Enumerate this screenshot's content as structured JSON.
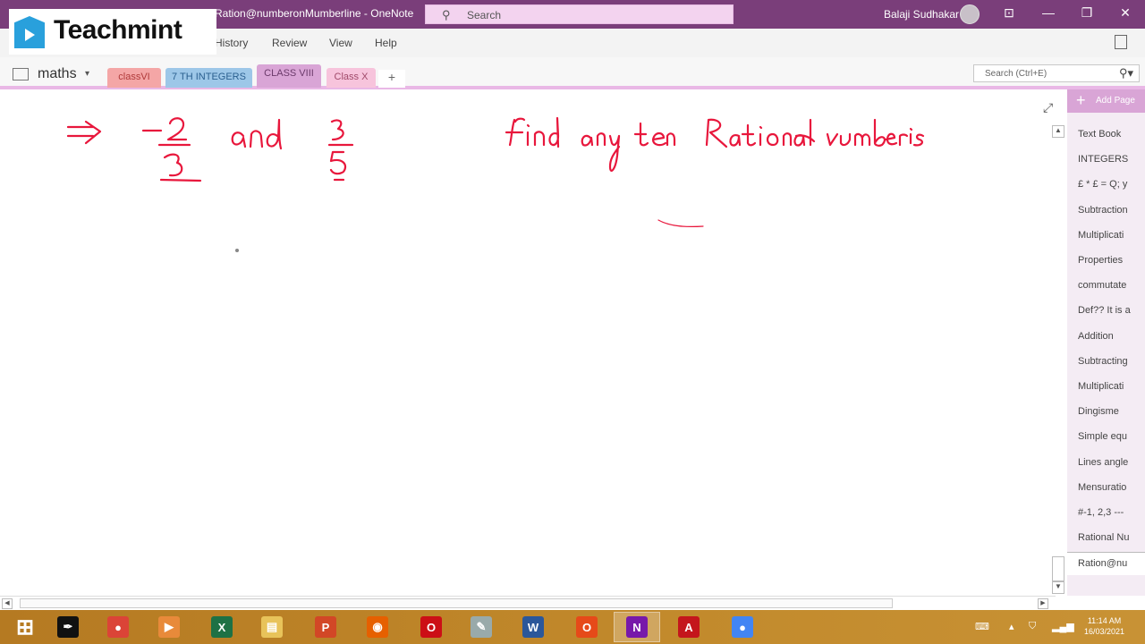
{
  "window": {
    "title": "Ration@numberonMumberline - OneNote",
    "search_placeholder": "Search",
    "user_name": "Balaji Sudhakar",
    "controls": {
      "ribbon_display": "⊡",
      "minimize": "—",
      "restore": "❐",
      "close": "✕"
    }
  },
  "watermark": {
    "brand": "Teachmint"
  },
  "ribbon": {
    "menu": [
      "History",
      "Review",
      "View",
      "Help"
    ]
  },
  "notebook": {
    "name": "maths",
    "caret": "▾",
    "sections": [
      {
        "label": "classVI",
        "color": "#f4a6a6",
        "text_color": "#b03a3a"
      },
      {
        "label": "7 TH INTEGERS",
        "color": "#9dc7e8",
        "text_color": "#2a5f8f"
      },
      {
        "label": "CLASS VIII",
        "color": "#d9a5d6",
        "text_color": "#6a3a6a"
      },
      {
        "label": "Class X",
        "color": "#f7c4dc",
        "text_color": "#a04a6a"
      }
    ],
    "add_section": "+",
    "search_placeholder": "Search (Ctrl+E)"
  },
  "page_pane": {
    "add_page_label": "Add Page",
    "pages": [
      "Text Book",
      "INTEGERS",
      "£ * £ = Q; y",
      "Subtraction",
      "Multiplicati",
      "Properties",
      "commutate",
      "Def?? It is a",
      "Addition",
      "Subtracting",
      "Multiplicati",
      "Dingisme",
      "Simple equ",
      "Lines angle",
      "Mensuratio",
      "#-1, 2,3 ---",
      "Rational Nu",
      "Ration@nu"
    ],
    "active_index": 17
  },
  "canvas": {
    "ink_color": "#e8173c",
    "handwriting": {
      "arrow": "⇒",
      "fraction_1": {
        "sign": "−",
        "numerator": "2",
        "denominator": "3"
      },
      "conjunction": "and",
      "fraction_2": {
        "numerator": "3",
        "denominator": "5"
      },
      "instruction": "find any ten Rational numbers"
    }
  },
  "taskbar": {
    "apps": [
      {
        "name": "windows-start",
        "glyph": "⊞",
        "bg": "transparent"
      },
      {
        "name": "pen-app",
        "glyph": "✒",
        "bg": "#111"
      },
      {
        "name": "chrome",
        "glyph": "●",
        "bg": "#db4437"
      },
      {
        "name": "media-player",
        "glyph": "▶",
        "bg": "#e88a3a"
      },
      {
        "name": "excel",
        "glyph": "X",
        "bg": "#1e7145"
      },
      {
        "name": "file-explorer",
        "glyph": "▤",
        "bg": "#e8c35a"
      },
      {
        "name": "powerpoint",
        "glyph": "P",
        "bg": "#d24726"
      },
      {
        "name": "firefox",
        "glyph": "◉",
        "bg": "#e66000"
      },
      {
        "name": "opera",
        "glyph": "O",
        "bg": "#cc0f16"
      },
      {
        "name": "paint",
        "glyph": "✎",
        "bg": "#9aa"
      },
      {
        "name": "word",
        "glyph": "W",
        "bg": "#2b579a"
      },
      {
        "name": "office",
        "glyph": "O",
        "bg": "#e64a19"
      },
      {
        "name": "onenote",
        "glyph": "N",
        "bg": "#7719aa"
      },
      {
        "name": "acrobat",
        "glyph": "A",
        "bg": "#c4161c"
      },
      {
        "name": "chrome-2",
        "glyph": "●",
        "bg": "#4285f4"
      }
    ],
    "active_app": "onenote",
    "clock_time": "11:14 AM",
    "clock_date": "16/03/2021"
  }
}
